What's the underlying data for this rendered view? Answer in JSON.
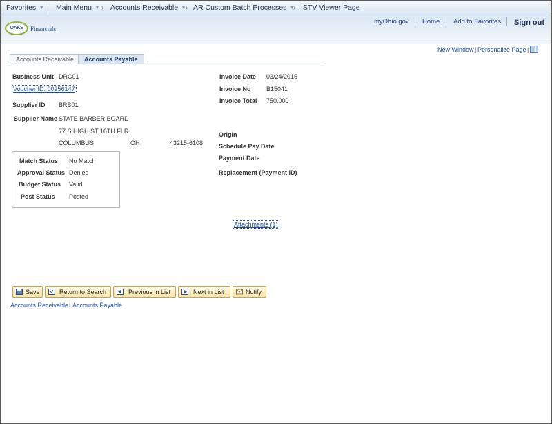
{
  "menubar": {
    "favorites": "Favorites",
    "main_menu": "Main Menu",
    "crumb1": "Accounts Receivable",
    "crumb2": "AR Custom Batch Processes",
    "crumb3": "ISTV Viewer Page"
  },
  "header": {
    "logo_text": "OAKS",
    "logo_sub": "Financials",
    "links": [
      "myOhio.gov",
      "Home",
      "Add to Favorites"
    ],
    "signout": "Sign out"
  },
  "utility": {
    "new_window": "New Window",
    "personalize": "Personalize Page",
    "sep": "|"
  },
  "tabs": [
    "Accounts Receivable",
    "Accounts Payable"
  ],
  "form": {
    "business_unit_label": "Business Unit",
    "business_unit": "DRC01",
    "voucher_link": "Voucher ID: 00256147",
    "supplier_id_label": "Supplier ID",
    "supplier_id": "BRB01",
    "supplier_name_label": "Supplier Name",
    "supplier_name": "STATE BARBER BOARD",
    "address_line": "77 S HIGH ST 16TH FLR",
    "city": "COLUMBUS",
    "state": "OH",
    "zip": "43215-6108",
    "invoice_date_label": "Invoice Date",
    "invoice_date": "03/24/2015",
    "invoice_no_label": "Invoice No",
    "invoice_no": "B15041",
    "invoice_total_label": "Invoice Total",
    "invoice_total": "750.000",
    "origin_label": "Origin",
    "schedule_pay_label": "Schedule Pay Date",
    "payment_date_label": "Payment Date",
    "replacement_label": "Replacement (Payment ID)"
  },
  "status": {
    "match_label": "Match Status",
    "match": "No Match",
    "approval_label": "Approval Status",
    "approval": "Denied",
    "budget_label": "Budget Status",
    "budget": "Valid",
    "post_label": "Post Status",
    "post": "Posted"
  },
  "attachments": "Attachments (1)",
  "buttons": {
    "save": "Save",
    "return": "Return to Search",
    "previous": "Previous in List",
    "next": "Next in List",
    "notify": "Notify"
  },
  "footer": {
    "ar": "Accounts Receivable",
    "ap": "Accounts Payable",
    "sep": "|"
  }
}
